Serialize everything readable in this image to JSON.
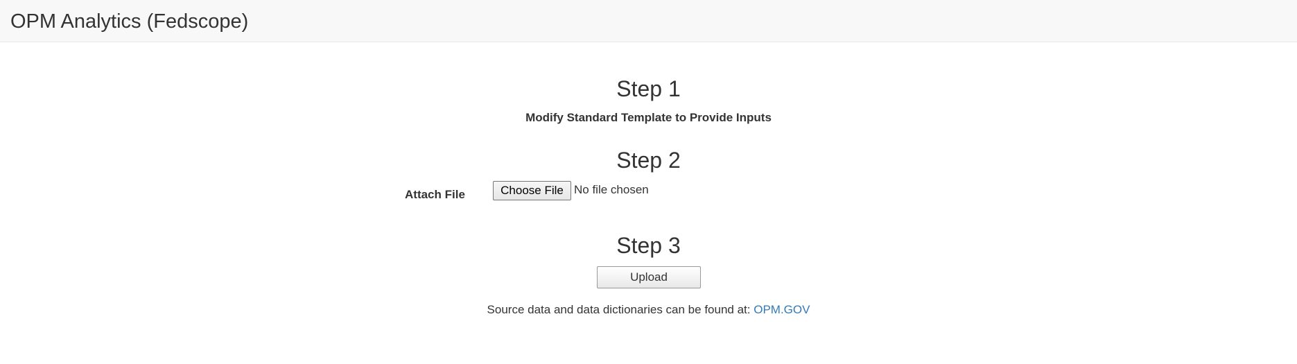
{
  "header": {
    "brand": "OPM Analytics (Fedscope)"
  },
  "steps": [
    {
      "heading": "Step 1",
      "description": "Modify Standard Template to Provide Inputs"
    },
    {
      "heading": "Step 2",
      "attach_label": "Attach File",
      "file_button_label": "Choose File",
      "file_status": "No file chosen"
    },
    {
      "heading": "Step 3",
      "upload_label": "Upload"
    }
  ],
  "footer": {
    "source_text": "Source data and data dictionaries can be found at: ",
    "source_link_label": "OPM.GOV"
  },
  "colors": {
    "navbar_bg": "#f8f8f8",
    "link": "#337ab7",
    "text": "#333333"
  }
}
